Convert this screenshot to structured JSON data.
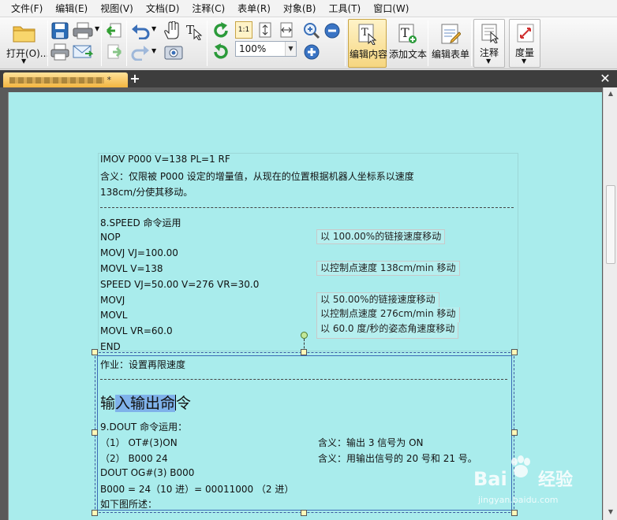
{
  "menu": [
    "文件(F)",
    "编辑(E)",
    "视图(V)",
    "文档(D)",
    "注释(C)",
    "表单(R)",
    "对象(B)",
    "工具(T)",
    "窗口(W)"
  ],
  "toolbar": {
    "open_label": "打开(O)...",
    "zoom_value": "100%",
    "edit_content_label": "编辑内容",
    "add_text_label": "添加文本",
    "edit_form_label": "编辑表单",
    "annotate_label": "注释",
    "measure_label": "度量"
  },
  "colors": {
    "page_bg": "#a9ecec",
    "active_tab": "#f2b540",
    "selection": "#7fb2ea"
  },
  "doc": {
    "lines_top": [
      "IMOV P000 V=138 PL=1 RF",
      "含义：仅限被 P000 设定的增量值，从现在的位置根据机器人坐标系以速度",
      "138cm/分使其移动。"
    ],
    "speed_title": "8.SPEED 命令运用",
    "speed_lines": [
      "NOP",
      "MOVJ VJ=100.00",
      "MOVL V=138",
      "SPEED VJ=50.00 V=276 VR=30.0",
      "MOVJ",
      "MOVL",
      "MOVL VR=60.0",
      "END"
    ],
    "speed_notes": [
      "以 100.00%的链接速度移动",
      "以控制点速度 138cm/min 移动",
      "以 50.00%的链接速度移动",
      "以控制点速度 276cm/min 移动",
      "以 60.0 度/秒的姿态角速度移动"
    ],
    "homework": "作业：设置再限速度",
    "heading_highlight": "入输出命",
    "heading_pre": "输",
    "heading_post": "令",
    "dout_title": "9.DOUT  命令运用：",
    "dout_items": [
      "（1）   OT#(3)ON",
      "（2）   B000 24"
    ],
    "dout_notes": [
      "含义：输出 3 信号为 ON",
      "含义：用输出信号的 20 号和 21 号。"
    ],
    "dout_line": "DOUT OG#(3) B000",
    "calc_line": "B000 = 24（10 进）= 00011000  （2 进）",
    "figure_line": "如下图所述："
  }
}
